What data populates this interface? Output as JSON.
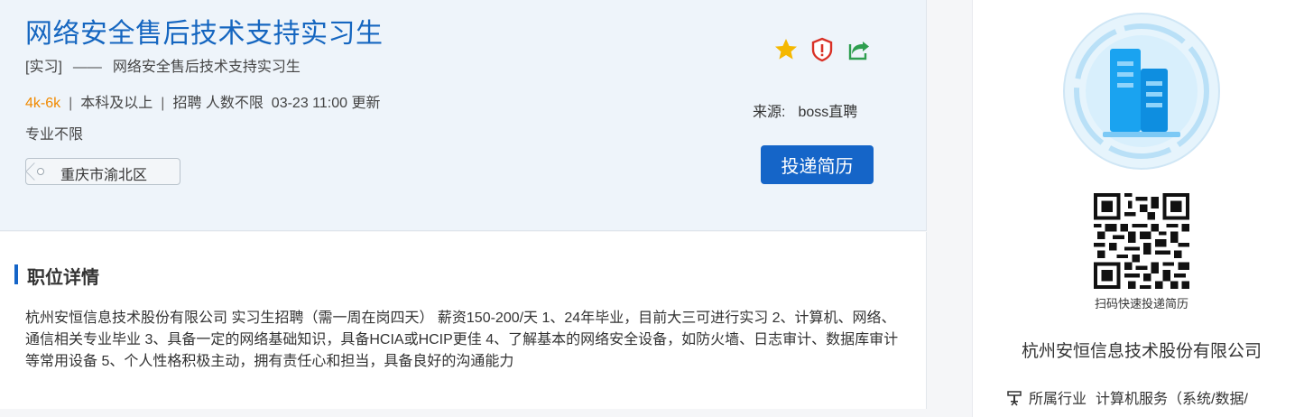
{
  "job": {
    "title": "网络安全售后技术支持实习生",
    "type_tag": "[实习]",
    "dash": "——",
    "subtitle_name": "网络安全售后技术支持实习生",
    "salary": "4k-6k",
    "separator": "|",
    "education": "本科及以上",
    "recruit": "招聘 人数不限",
    "updated": "03-23 11:00 更新",
    "major": "专业不限",
    "location": "重庆市渝北区"
  },
  "actions": {
    "icons": [
      "star-icon",
      "report-shield-icon",
      "share-icon"
    ]
  },
  "source": {
    "label": "来源:",
    "value": "boss直聘"
  },
  "apply_button": "投递简历",
  "detail": {
    "section_title": "职位详情",
    "description": "杭州安恒信息技术股份有限公司 实习生招聘（需一周在岗四天） 薪资150-200/天 1、24年毕业，目前大三可进行实习 2、计算机、网络、通信相关专业毕业 3、具备一定的网络基础知识，具备HCIA或HCIP更佳 4、了解基本的网络安全设备，如防火墙、日志审计、数据库审计等常用设备 5、个人性格积极主动，拥有责任心和担当，具备良好的沟通能力"
  },
  "sidebar": {
    "qr_caption": "扫码快速投递简历",
    "company_name": "杭州安恒信息技术股份有限公司",
    "industry_label": "所属行业",
    "industry_value": "计算机服务（系统/数据/"
  },
  "colors": {
    "primary": "#1565c8",
    "salary": "#f08a00",
    "header_bg": "#eef4fa",
    "star": "#f5b800",
    "shield": "#d93025",
    "share": "#2e9e4f"
  }
}
